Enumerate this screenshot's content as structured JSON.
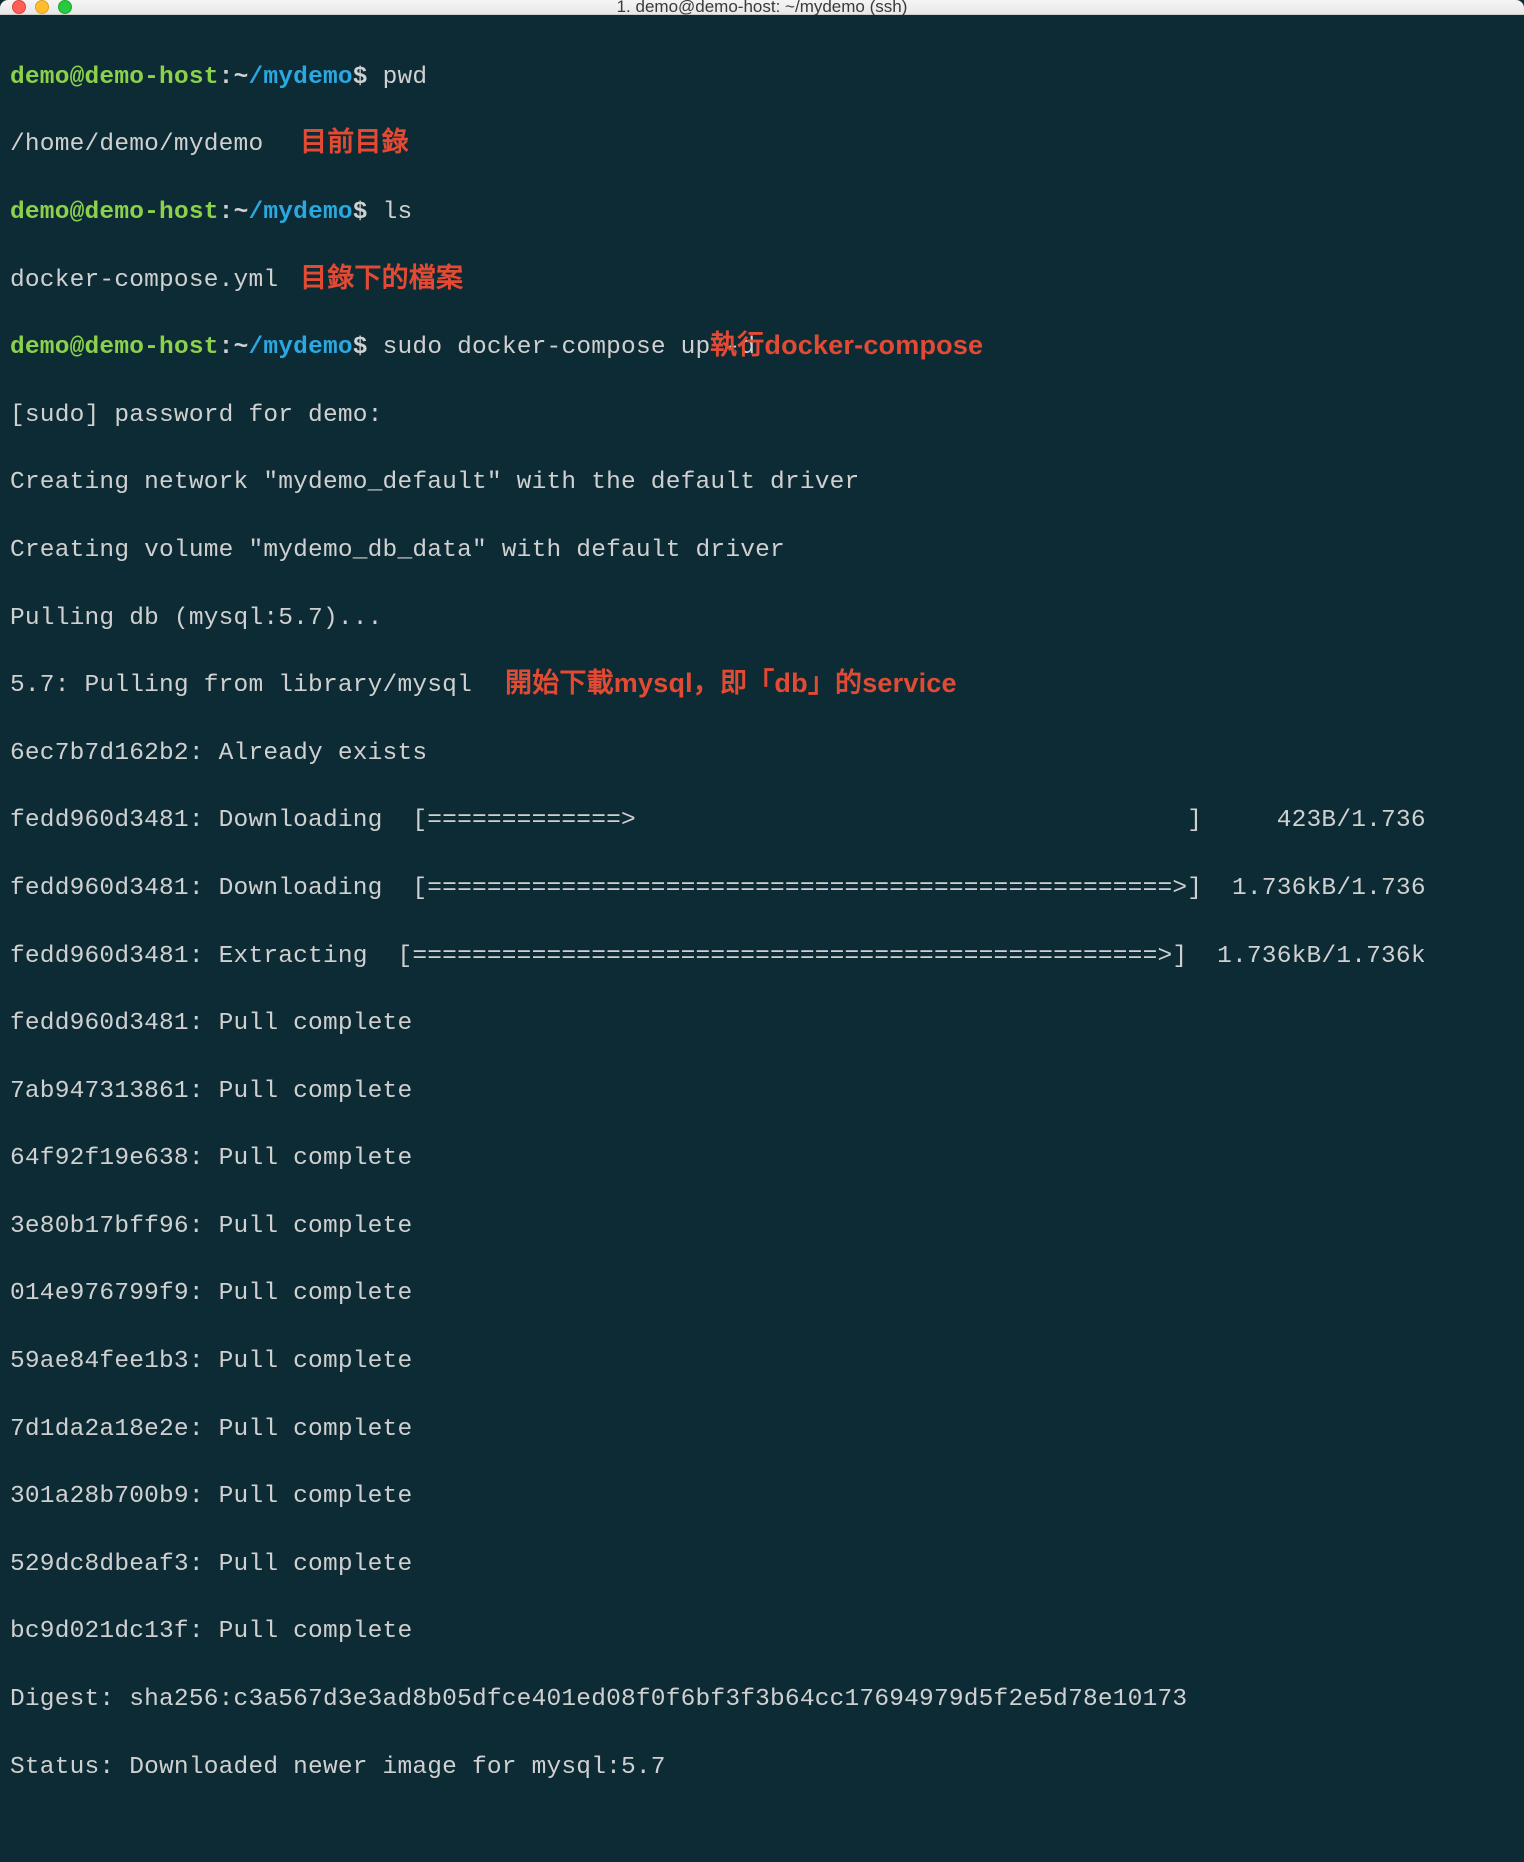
{
  "window": {
    "title": "1. demo@demo-host: ~/mydemo (ssh)"
  },
  "prompt": {
    "user": "demo",
    "at": "@",
    "host": "demo-host",
    "colon": ":",
    "tilde": "~",
    "slash": "/",
    "dir": "mydemo",
    "dollar": "$"
  },
  "cmds": {
    "pwd": "pwd",
    "ls": "ls",
    "compose": "sudo docker-compose up -d"
  },
  "out": {
    "pwd": "/home/demo/mydemo",
    "ls": "docker-compose.yml",
    "sudo_prompt": "[sudo] password for demo:",
    "net": "Creating network \"mydemo_default\" with the default driver",
    "vol": "Creating volume \"mydemo_db_data\" with default driver",
    "pull_db": "Pulling db (mysql:5.7)...",
    "pull_from": "5.7: Pulling from library/mysql",
    "layer_exists": "6ec7b7d162b2: Already exists",
    "dl1": "fedd960d3481: Downloading  [=============>                                     ]     423B/1.736",
    "dl2": "fedd960d3481: Downloading  [==================================================>]  1.736kB/1.736",
    "ext": "fedd960d3481: Extracting  [==================================================>]  1.736kB/1.736k",
    "pc1": "fedd960d3481: Pull complete",
    "pc2": "7ab947313861: Pull complete",
    "pc3": "64f92f19e638: Pull complete",
    "pc4": "3e80b17bff96: Pull complete",
    "pc5": "014e976799f9: Pull complete",
    "pc6": "59ae84fee1b3: Pull complete",
    "pc7": "7d1da2a18e2e: Pull complete",
    "pc8": "301a28b700b9: Pull complete",
    "pc9": "529dc8dbeaf3: Pull complete",
    "pc10": "bc9d021dc13f: Pull complete",
    "digest": "Digest: sha256:c3a567d3e3ad8b05dfce401ed08f0f6bf3f3b64cc17694979d5f2e5d78e10173",
    "status": "Status: Downloaded newer image for mysql:5.7"
  },
  "ann": {
    "a1": "目前目錄",
    "a2": "目錄下的檔案",
    "a3": "執行docker-compose",
    "a4": "開始下載mysql，即「db」的service"
  }
}
